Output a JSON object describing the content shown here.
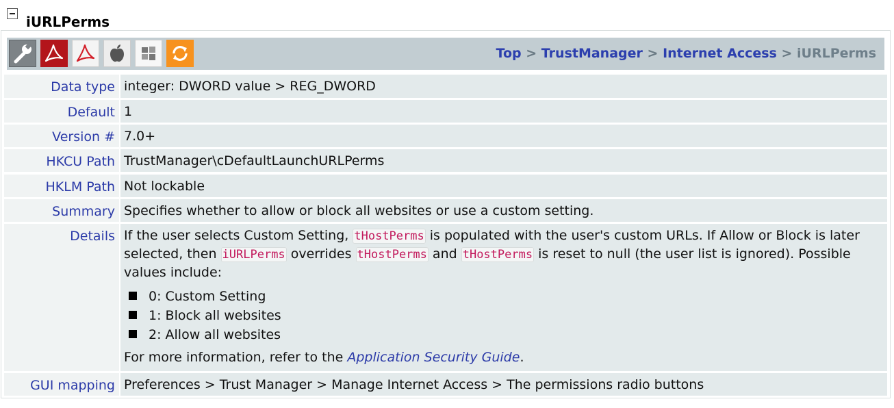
{
  "page": {
    "title": "iURLPerms"
  },
  "toolbar": {
    "icons": [
      "wrench-icon",
      "acrobat-icon",
      "reader-icon",
      "apple-icon",
      "windows-icon",
      "sync-icon"
    ],
    "breadcrumb": {
      "top": "Top",
      "sep": ">",
      "trust_manager": "TrustManager",
      "internet_access": "Internet Access",
      "current": "iURLPerms"
    }
  },
  "rows": {
    "data_type": {
      "label": "Data type",
      "value": "integer: DWORD value > REG_DWORD"
    },
    "default": {
      "label": "Default",
      "value": "1"
    },
    "version": {
      "label": "Version #",
      "value": "7.0+"
    },
    "hkcu": {
      "label": "HKCU Path",
      "value": "TrustManager\\cDefaultLaunchURLPerms"
    },
    "hklm": {
      "label": "HKLM Path",
      "value": "Not lockable"
    },
    "summary": {
      "label": "Summary",
      "value": "Specifies whether to allow or block all websites or use a custom setting."
    },
    "details": {
      "label": "Details",
      "text1": "If the user selects Custom Setting, ",
      "code1": "tHostPerms",
      "text2": " is populated with the user's custom URLs. If Allow or Block is later selected, then ",
      "code2": "iURLPerms",
      "text3": " overrides ",
      "code3": "tHostPerms",
      "text4": " and ",
      "code4": "tHostPerms",
      "text5": " is reset to null (the user list is ignored). Possible values include:",
      "values": [
        "0: Custom Setting",
        "1: Block all websites",
        "2: Allow all websites"
      ],
      "more_prefix": "For more information, refer to the ",
      "more_link": "Application Security Guide",
      "more_suffix": "."
    },
    "gui_mapping": {
      "label": "GUI mapping",
      "value": "Preferences > Trust Manager > Manage Internet Access > The permissions radio buttons"
    }
  },
  "colors": {
    "label_text": "#2b3aa8",
    "label_bg": "#f0f3f3",
    "value_bg": "#e3eaeb",
    "toolbar_bg": "#c2cdd2",
    "code_text": "#c2185b"
  }
}
